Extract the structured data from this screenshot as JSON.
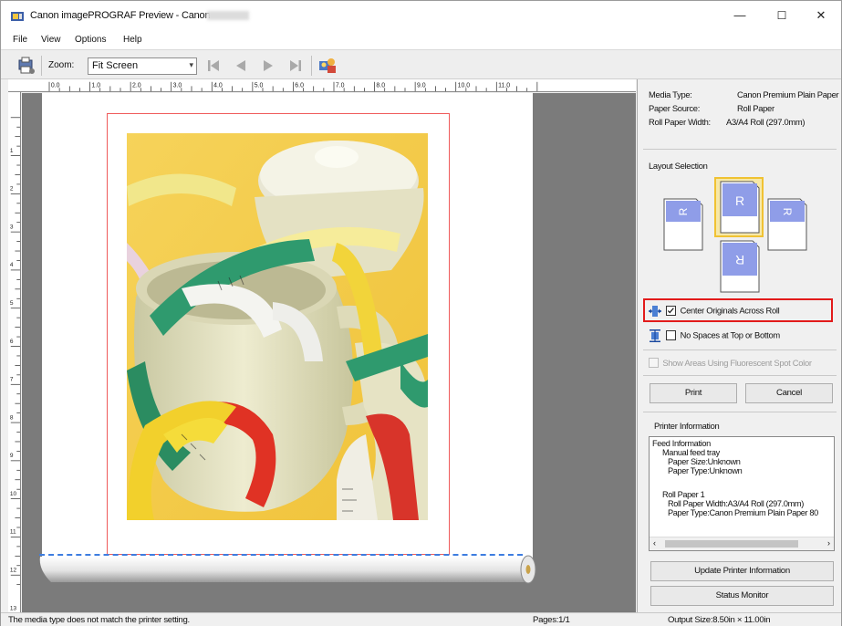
{
  "window": {
    "title": "Canon imagePROGRAF Preview - Canon",
    "minimize_glyph": "—",
    "maximize_glyph": "☐",
    "close_glyph": "✕"
  },
  "menu": [
    "File",
    "View",
    "Options",
    "Help"
  ],
  "toolbar": {
    "zoom_label": "Zoom:",
    "zoom_value": "Fit Screen",
    "icons": [
      "printer-settings-icon",
      "first-page-icon",
      "previous-page-icon",
      "next-page-icon",
      "last-page-icon",
      "layout-people-icon"
    ]
  },
  "ruler": {
    "h_labels": [
      "0.0",
      "1.0",
      "2.0",
      "3.0",
      "4.0",
      "5.0",
      "6.0",
      "7.0",
      "8.0",
      "9.0",
      "10.0",
      "11.0"
    ],
    "v_labels": [
      "1",
      "2",
      "3",
      "4",
      "5",
      "6",
      "7",
      "8",
      "9",
      "10",
      "11",
      "12",
      "13"
    ]
  },
  "media": {
    "type_label": "Media Type:",
    "type_value": "Canon Premium Plain Paper",
    "source_label": "Paper Source:",
    "source_value": "Roll Paper",
    "width_label": "Roll Paper Width:",
    "width_value": "A3/A4 Roll (297.0mm)"
  },
  "layout": {
    "title": "Layout Selection",
    "selected": "R-up",
    "options": [
      {
        "name": "rotate-left",
        "glyph": "R"
      },
      {
        "name": "upright",
        "glyph": "R"
      },
      {
        "name": "rotate-right",
        "glyph": "R"
      },
      {
        "name": "upside-down",
        "glyph": "R"
      }
    ]
  },
  "options": {
    "center_originals": "Center Originals Across Roll",
    "center_checked": true,
    "no_spaces": "No Spaces at Top or Bottom",
    "no_spaces_checked": false,
    "fluorescent": "Show Areas Using Fluorescent Spot Color",
    "fluorescent_checked": false
  },
  "buttons": {
    "print": "Print",
    "cancel": "Cancel",
    "update": "Update Printer Information",
    "status_monitor": "Status Monitor"
  },
  "printer_info": {
    "title": "Printer Information",
    "lines": [
      "Feed Information",
      "Manual feed tray",
      "Paper Size:Unknown",
      "Paper Type:Unknown",
      "",
      "Roll Paper 1",
      "Roll Paper Width:A3/A4 Roll (297.0mm)",
      "Paper Type:Canon Premium Plain Paper 80"
    ]
  },
  "status": {
    "message": "The media type does not match the printer setting.",
    "pages": "Pages:1/1",
    "output_size": "Output Size:8.50in × 11.00in"
  },
  "colors": {
    "highlight": "#e21b1b",
    "print_border": "#ef5a5a",
    "cut_line": "#3d7de0",
    "selected_layout": "#f0c232",
    "layout_blue": "#8f9de8"
  }
}
